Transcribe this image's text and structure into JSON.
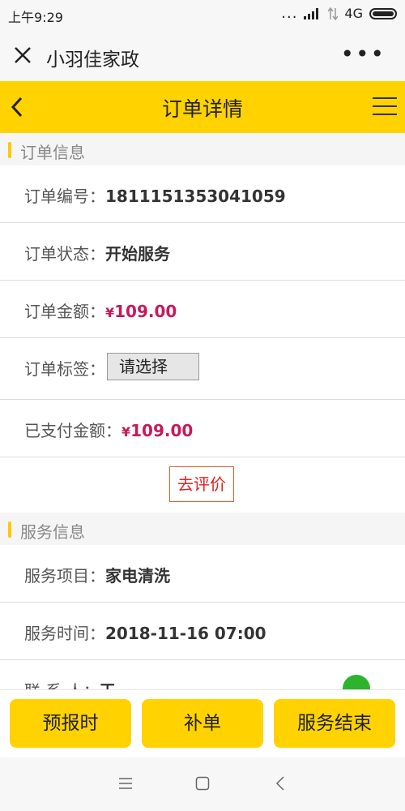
{
  "status": {
    "time": "上午9:29",
    "network": "4G",
    "more": "..."
  },
  "topbar": {
    "title": "小羽佳家政",
    "more": "•••"
  },
  "header": {
    "title": "订单详情"
  },
  "sections": {
    "order_info": "订单信息",
    "service_info": "服务信息"
  },
  "order": {
    "number_label": "订单编号：",
    "number": "1811151353041059",
    "status_label": "订单状态：",
    "status": "开始服务",
    "amount_label": "订单金额：",
    "amount_currency": "¥",
    "amount": "109.00",
    "tag_label": "订单标签：",
    "tag_placeholder": "请选择",
    "paid_label": "已支付金额：",
    "paid_currency": "¥",
    "paid": "109.00",
    "review_button": "去评价"
  },
  "service": {
    "item_label": "服务项目：",
    "item": "家电清洗",
    "time_label": "服务时间：",
    "time": "2018-11-16 07:00",
    "contact_label": "联 系 人：",
    "contact": "王"
  },
  "actions": {
    "report_time": "预报时",
    "supplement": "补单",
    "end_service": "服务结束"
  },
  "colors": {
    "accent": "#ffd200",
    "price": "#c8195a",
    "review_border": "#e0602a",
    "phone": "#2db32d"
  },
  "icons": [
    "close-icon",
    "more-icon",
    "back-icon",
    "menu-icon",
    "phone-icon",
    "signal-icon",
    "battery-icon",
    "nav-menu-icon",
    "nav-home-icon",
    "nav-back-icon"
  ]
}
